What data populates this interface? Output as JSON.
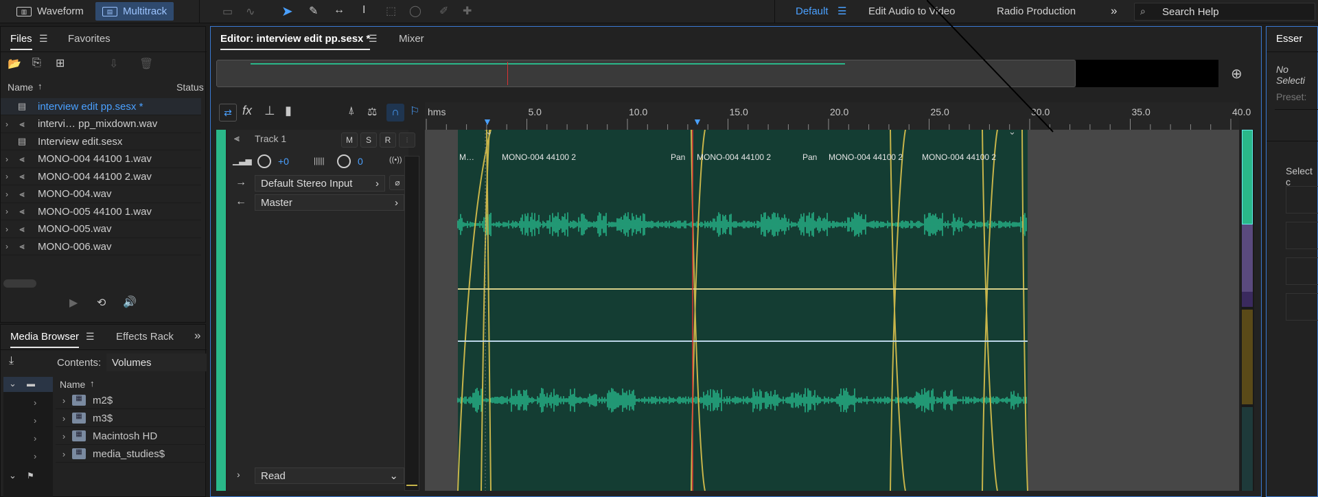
{
  "topbar": {
    "waveform_label": "Waveform",
    "multitrack_label": "Multitrack",
    "workspaces": [
      "Default",
      "Edit Audio to Video",
      "Radio Production"
    ],
    "search_placeholder": "Search Help"
  },
  "files_panel": {
    "tabs": [
      "Files",
      "Favorites"
    ],
    "col_name": "Name",
    "col_status": "Status",
    "items": [
      {
        "name": "interview edit pp.sesx *",
        "type": "session",
        "expandable": false,
        "selected": true
      },
      {
        "name": "intervi… pp_mixdown.wav",
        "type": "wave",
        "expandable": true
      },
      {
        "name": "Interview edit.sesx",
        "type": "session",
        "expandable": false
      },
      {
        "name": "MONO-004 44100 1.wav",
        "type": "wave",
        "expandable": true
      },
      {
        "name": "MONO-004 44100 2.wav",
        "type": "wave",
        "expandable": true
      },
      {
        "name": "MONO-004.wav",
        "type": "wave",
        "expandable": true
      },
      {
        "name": "MONO-005 44100 1.wav",
        "type": "wave",
        "expandable": true
      },
      {
        "name": "MONO-005.wav",
        "type": "wave",
        "expandable": true
      },
      {
        "name": "MONO-006.wav",
        "type": "wave",
        "expandable": true
      }
    ]
  },
  "media_browser": {
    "tabs": [
      "Media Browser",
      "Effects Rack"
    ],
    "contents_label": "Contents:",
    "contents_value": "Volumes",
    "col_name": "Name",
    "volumes": [
      "m2$",
      "m3$",
      "Macintosh HD",
      "media_studies$"
    ]
  },
  "editor": {
    "tabs": [
      "Editor: interview edit pp.sesx *",
      "Mixer"
    ],
    "ruler_unit": "hms",
    "ruler_ticks": [
      "5.0",
      "10.0",
      "15.0",
      "20.0",
      "25.0",
      "30.0",
      "35.0",
      "40.0"
    ],
    "track": {
      "name": "Track 1",
      "buttons": [
        "M",
        "S",
        "R"
      ],
      "volume": "+0",
      "pan": "0",
      "input": "Default Stereo Input",
      "output": "Master",
      "automation": "Read"
    },
    "clips": [
      "M…",
      "MONO-004 44100 2",
      "MONO-004 44100 2",
      "MONO-004 44100 2",
      "MONO-004 44100 2"
    ],
    "pan_labels": [
      "Pan",
      "Pan"
    ]
  },
  "essential_panel": {
    "title": "Esser",
    "no_selection": "No Selecti",
    "preset_label": "Preset:",
    "select_label": "Select c"
  },
  "colors": {
    "accent": "#2d8cff",
    "track_green": "#2ab889",
    "clip_bg": "#143d33",
    "wave": "#2bd4a0",
    "fade": "#c8b54a"
  }
}
